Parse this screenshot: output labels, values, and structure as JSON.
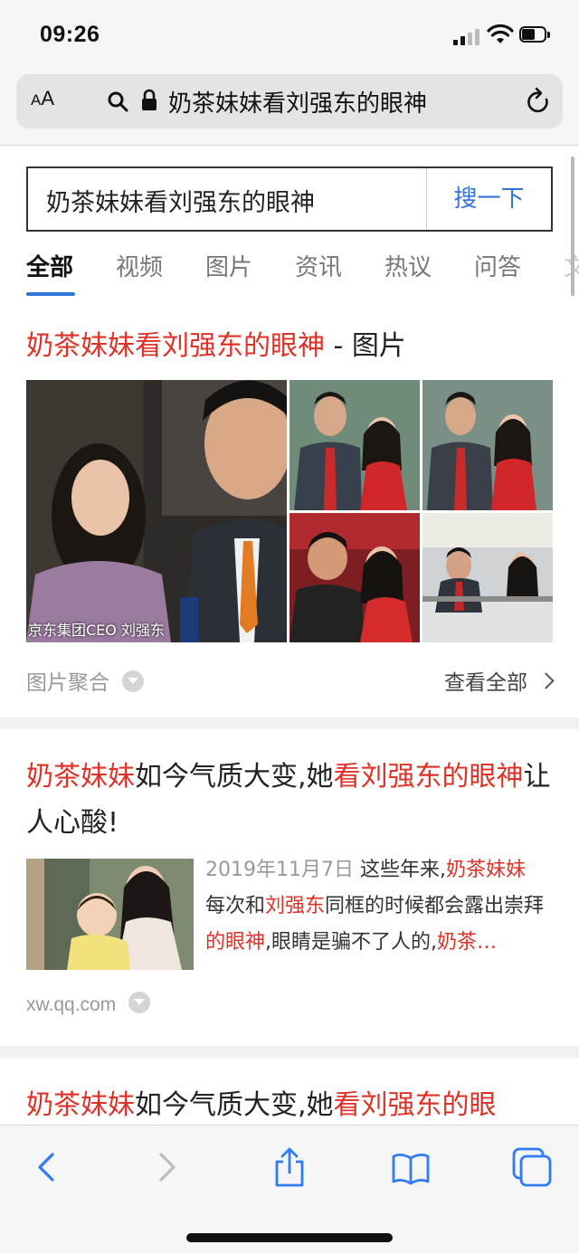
{
  "status_bar": {
    "time": "09:26"
  },
  "address_bar": {
    "aa_label_small": "A",
    "aa_label_big": "A",
    "url_text": "奶茶妹妹看刘强东的眼神"
  },
  "search": {
    "query": "奶茶妹妹看刘强东的眼神",
    "button_label": "搜一下"
  },
  "tabs": [
    {
      "label": "全部",
      "active": true
    },
    {
      "label": "视频",
      "active": false
    },
    {
      "label": "图片",
      "active": false
    },
    {
      "label": "资讯",
      "active": false
    },
    {
      "label": "热议",
      "active": false
    },
    {
      "label": "问答",
      "active": false
    },
    {
      "label": "文",
      "active": false
    }
  ],
  "image_result": {
    "title_highlight": "奶茶妹妹看刘强东的眼神",
    "title_suffix": " - 图片",
    "main_image_caption": "京东集团CEO 刘强东",
    "footer_left": "图片聚合",
    "footer_right": "查看全部"
  },
  "result_1": {
    "title_parts": [
      {
        "text": "奶茶妹妹",
        "highlight": true
      },
      {
        "text": "如今气质大变,她",
        "highlight": false
      },
      {
        "text": "看刘强东的眼神",
        "highlight": true
      },
      {
        "text": "让人心酸!",
        "highlight": false
      }
    ],
    "date": "2019年11月7日",
    "snippet_parts": [
      {
        "text": " 这些年来,",
        "highlight": false
      },
      {
        "text": "奶茶妹妹",
        "highlight": true
      },
      {
        "text": "每次和",
        "highlight": false
      },
      {
        "text": "刘强东",
        "highlight": true
      },
      {
        "text": "同框的时候都会露出崇拜",
        "highlight": false
      },
      {
        "text": "的眼神",
        "highlight": true
      },
      {
        "text": ",眼睛是骗不了人的,",
        "highlight": false
      },
      {
        "text": "奶茶…",
        "highlight": true
      }
    ],
    "source": "xw.qq.com"
  },
  "result_2": {
    "title_parts": [
      {
        "text": "奶茶妹妹",
        "highlight": true
      },
      {
        "text": "如今气质大变,她",
        "highlight": false
      },
      {
        "text": "看刘强东的眼",
        "highlight": true
      }
    ]
  },
  "colors": {
    "accent_blue": "#3173d6",
    "highlight_red": "#e03127"
  },
  "toolbar_icons": [
    "back-icon",
    "forward-icon",
    "share-icon",
    "bookmarks-icon",
    "tabs-icon"
  ]
}
